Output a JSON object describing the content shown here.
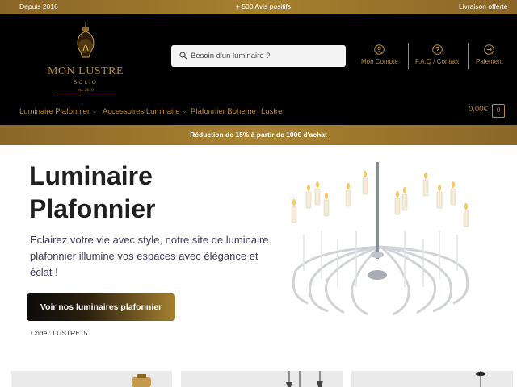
{
  "topbar": {
    "left": "Depuis 2016",
    "center": "+ 500 Avis positifs",
    "right": "Livraison offerte"
  },
  "logo": {
    "title": "MON LUSTRE",
    "subtitle": "SOLIO",
    "est": "est. 2016"
  },
  "search": {
    "placeholder": "Besoin d'un luminaire ?"
  },
  "header_links": [
    {
      "label": "Mon Compte",
      "icon": "user-icon"
    },
    {
      "label": "F.A.Q / Contact",
      "icon": "help-icon"
    },
    {
      "label": "Paiement",
      "icon": "arrow-right-icon"
    }
  ],
  "nav": [
    {
      "label": "Luminaire Plafonnier",
      "chevron": true
    },
    {
      "label": "Accessoires Luminaire",
      "chevron": true
    },
    {
      "label": "Plafonnier Boheme",
      "chevron": false
    },
    {
      "label": "Lustre",
      "chevron": false
    }
  ],
  "cart": {
    "total": "0,00€",
    "count": "0"
  },
  "promo": "Réduction de 15% à partir de 100€ d'achat",
  "hero": {
    "title_line1": "Luminaire",
    "title_line2": "Plafonnier",
    "text": "Éclairez votre vie avec style, notre site de luminaire plafonnier illumine vos espaces avec élégance et éclat !",
    "cta": "Voir nos luminaires plafonnier",
    "code": "Code : LUSTRE15"
  },
  "colors": {
    "gold": "#b58a37",
    "black": "#000000",
    "bar_gold": "#a5812f"
  }
}
